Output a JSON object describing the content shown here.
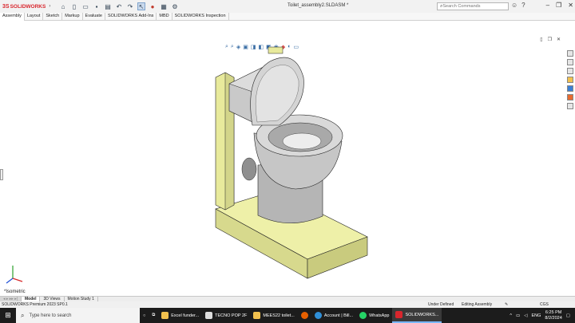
{
  "titlebar": {
    "logo_ds": "3S",
    "logo_brand": "SOLIDWORKS",
    "doc_title": "Toilet_assembly2.SLDASM *",
    "search_placeholder": "Search Commands"
  },
  "tabs": [
    "Assembly",
    "Layout",
    "Sketch",
    "Markup",
    "Evaluate",
    "SOLIDWORKS Add-Ins",
    "MBD",
    "SOLIDWORKS Inspection"
  ],
  "viewport": {
    "view_label": "*Isometric"
  },
  "bottom_tabs": [
    "Model",
    "3D Views",
    "Motion Study 1"
  ],
  "status": {
    "product": "SOLIDWORKS Premium 2023 SP0.1",
    "under_defined": "Under Defined",
    "editing": "Editing Assembly",
    "units": "CGS"
  },
  "taskbar": {
    "search_text": "Type here to search",
    "apps": [
      {
        "label": "Excel funder...",
        "color": "#f2c14e"
      },
      {
        "label": "TECNO POP 2F",
        "color": "#dddddd"
      },
      {
        "label": "MEES22 toilet...",
        "color": "#f2c14e"
      },
      {
        "label": "Account | Bill...",
        "color": "#2f8fd8"
      },
      {
        "label": "WhatsApp",
        "color": "#25d366"
      },
      {
        "label": "SOLIDWORKS...",
        "color": "#d8262d"
      }
    ],
    "lang": "ENG",
    "time": "6:25 PM",
    "date": "8/2/2024"
  }
}
